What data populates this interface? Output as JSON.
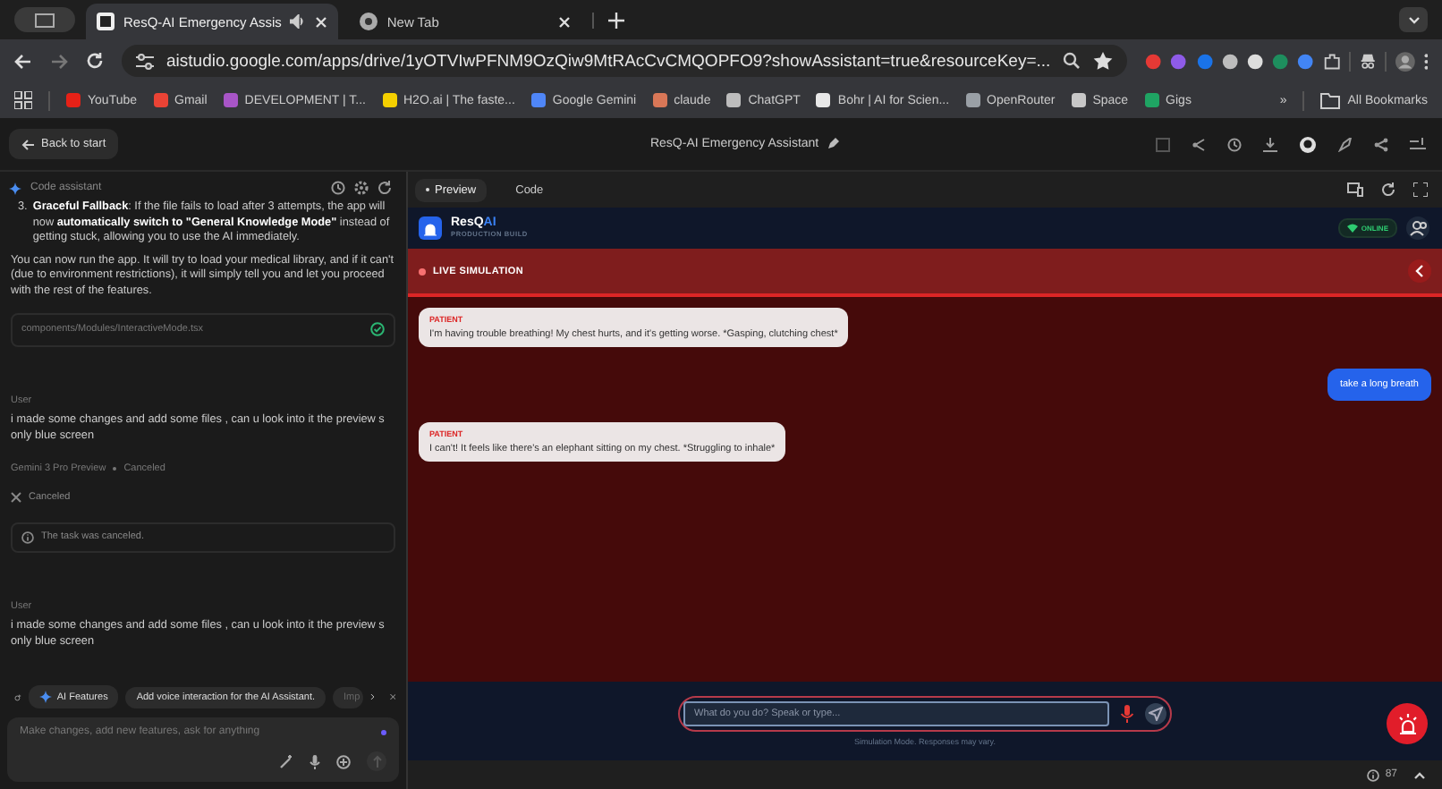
{
  "browser": {
    "tabs": [
      {
        "title": "ResQ-AI Emergency Assis",
        "selected": true,
        "audio": true
      },
      {
        "title": "New Tab",
        "selected": false,
        "audio": false
      }
    ],
    "url": "aistudio.google.com/apps/drive/1yOTVIwPFNM9OzQiw9MtRAcCvCMQOPFO9?showAssistant=true&resourceKey=...",
    "bookmarks": [
      {
        "label": "YouTube",
        "color": "#e62117"
      },
      {
        "label": "Gmail",
        "color": "#ea4335"
      },
      {
        "label": "DEVELOPMENT | T...",
        "color": "#a855c7"
      },
      {
        "label": "H2O.ai | The faste...",
        "color": "#f5d000"
      },
      {
        "label": "Google Gemini",
        "color": "#4f86f7"
      },
      {
        "label": "claude",
        "color": "#d97757"
      },
      {
        "label": "ChatGPT",
        "color": "#bdbdbd"
      },
      {
        "label": "Bohr | AI for Scien...",
        "color": "#e8e8e8"
      },
      {
        "label": "OpenRouter",
        "color": "#9aa0a6"
      },
      {
        "label": "Space",
        "color": "#c7c7c7"
      },
      {
        "label": "Gigs",
        "color": "#1fa463"
      }
    ],
    "more": "»",
    "all_bookmarks": "All Bookmarks"
  },
  "header": {
    "back": "Back to start",
    "title": "ResQ-AI Emergency Assistant"
  },
  "assistant": {
    "title": "Code assistant",
    "items": [
      {
        "kind": "list_item",
        "number": "3.",
        "text": "**Graceful Fallback**: If the file fails to load after 3 attempts, the app will now **automatically switch to \"General Knowledge Mode\"** instead of getting stuck, allowing you to use the AI immediately."
      },
      {
        "kind": "paragraph",
        "text": "You can now run the app. It will try to load your medical library, and if it can't (due to environment restrictions), it will simply tell you and let you proceed with the rest of the features."
      },
      {
        "kind": "file",
        "text": "components/Modules/InteractiveMode.tsx"
      },
      {
        "kind": "user",
        "label": "User",
        "text": "i made some changes and add some files , can u look into it the preview s only blue screen"
      },
      {
        "kind": "status",
        "model": "Gemini 3 Pro Preview",
        "state": "Canceled"
      },
      {
        "kind": "canceled",
        "text": "Canceled"
      },
      {
        "kind": "notice",
        "text": "The task was canceled."
      },
      {
        "kind": "user",
        "label": "User",
        "text": "i made some changes and add some files , can u look into it the preview s only blue screen"
      }
    ],
    "chips": [
      {
        "label": "AI Features",
        "kind": "feature"
      },
      {
        "label": "Add voice interaction for the AI Assistant.",
        "kind": "suggestion"
      },
      {
        "label": "Imp",
        "kind": "faded"
      }
    ],
    "placeholder": "Make changes, add new features, ask for anything"
  },
  "preview": {
    "tabs": [
      {
        "label": "Preview",
        "selected": true
      },
      {
        "label": "Code",
        "selected": false
      }
    ],
    "brand": "ResQ",
    "brand_suffix": "AI",
    "subtitle": "PRODUCTION BUILD",
    "status": "ONLINE",
    "simulation": "LIVE SIMULATION",
    "messages": [
      {
        "kind": "patient",
        "label": "PATIENT",
        "text": "I'm having trouble breathing! My chest hurts, and it's getting worse. *Gasping, clutching chest*"
      },
      {
        "kind": "user",
        "text": "take a long breath"
      },
      {
        "kind": "patient",
        "label": "PATIENT",
        "text": "I can't! It feels like there's an elephant sitting on my chest. *Struggling to inhale*"
      }
    ],
    "placeholder": "What do you do? Speak or type...",
    "footnote": "Simulation Mode. Responses may vary.",
    "issues": "87"
  }
}
